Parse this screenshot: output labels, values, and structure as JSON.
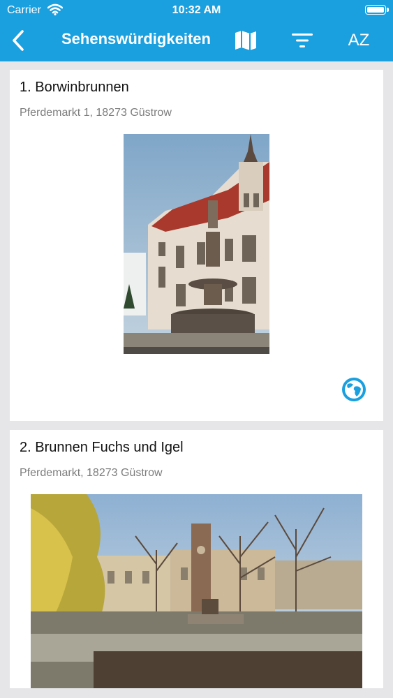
{
  "status_bar": {
    "carrier": "Carrier",
    "time": "10:32 AM"
  },
  "nav": {
    "title": "Sehenswürdigkeiten",
    "sort_label": "AZ",
    "icons": [
      "back-chevron-icon",
      "map-icon",
      "filter-icon",
      "sort-az-icon"
    ]
  },
  "colors": {
    "accent": "#1a9fdf",
    "background": "#e6e6e9",
    "card": "#ffffff",
    "address": "#7d7d7d"
  },
  "places": [
    {
      "title": "1. Borwinbrunnen",
      "address": "Pferdemarkt 1, 18273 Güstrow",
      "icon": "globe-icon"
    },
    {
      "title": "2. Brunnen Fuchs und Igel",
      "address": "Pferdemarkt, 18273 Güstrow"
    }
  ]
}
